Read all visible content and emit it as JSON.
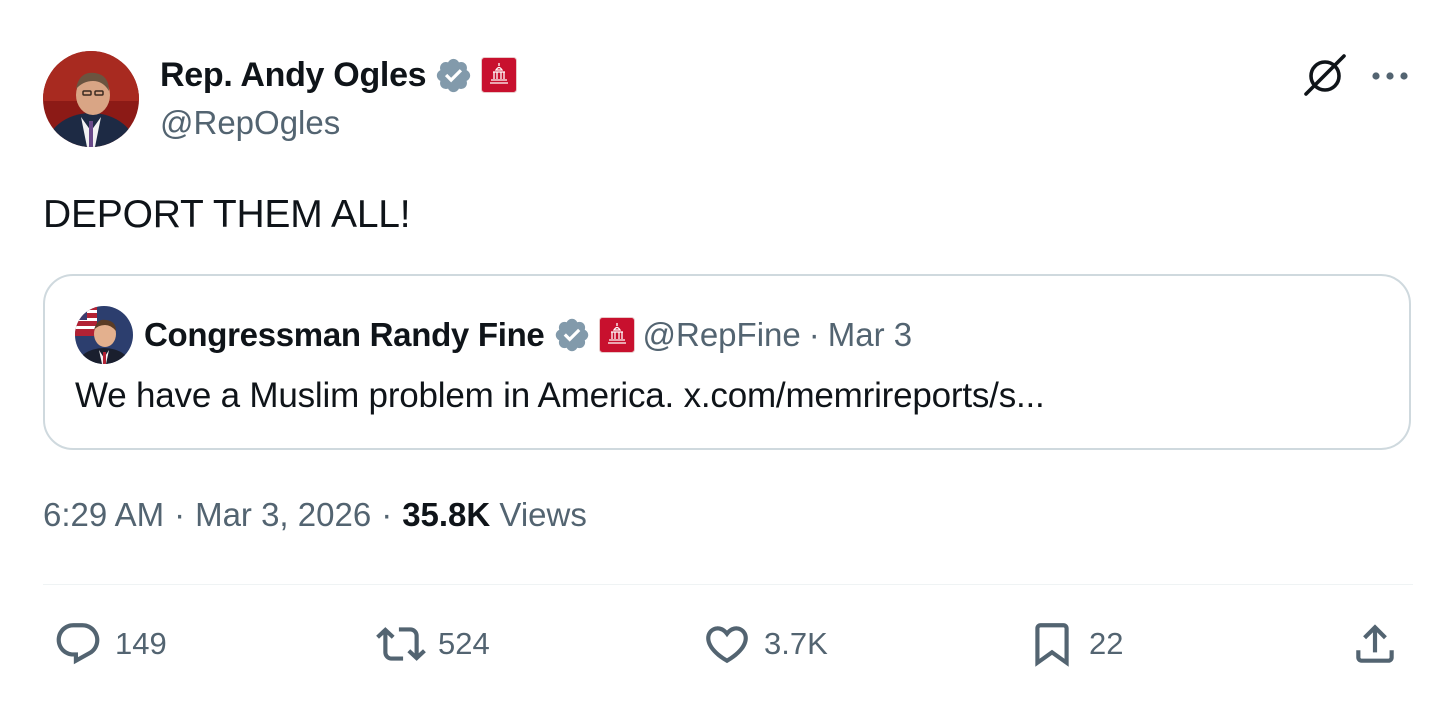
{
  "author": {
    "display_name": "Rep. Andy Ogles",
    "handle": "@RepOgles",
    "verified_icon": "verified-badge-icon",
    "affiliation_icon": "government-badge-icon",
    "avatar_description": "avatar"
  },
  "tweet": {
    "text": "DEPORT THEM ALL!",
    "time": "6:29 AM",
    "separator": "·",
    "date": "Mar 3, 2026",
    "views_count": "35.8K",
    "views_label": "Views"
  },
  "quote": {
    "display_name": "Congressman Randy Fine",
    "handle": "@RepFine",
    "separator": "·",
    "date": "Mar 3",
    "text": "We have a Muslim problem in America. x.com/memrireports/s..."
  },
  "actions": {
    "reply_count": "149",
    "repost_count": "524",
    "like_count": "3.7K",
    "bookmark_count": "22"
  },
  "colors": {
    "text_primary": "#0f1419",
    "text_secondary": "#536471",
    "border": "#cfd9de",
    "verified_gray": "#829aab",
    "gov_red": "#c8102e",
    "divider": "#eff3f4"
  }
}
